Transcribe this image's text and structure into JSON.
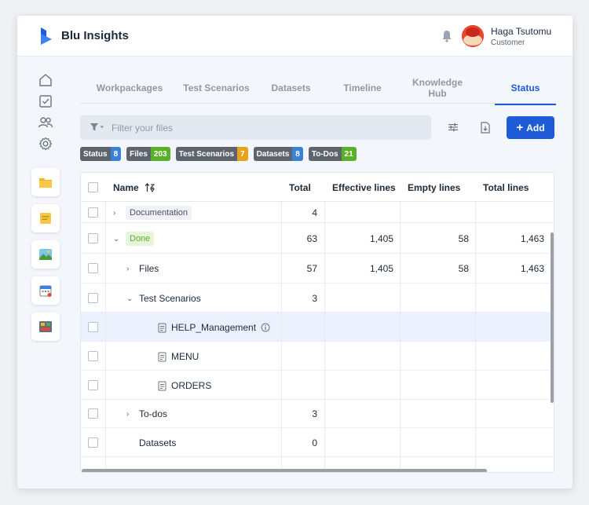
{
  "app": {
    "brand": "Blu Insights"
  },
  "user": {
    "name": "Haga Tsutomu",
    "role": "Customer"
  },
  "tabs": [
    {
      "label": "Workpackages",
      "active": false
    },
    {
      "label": "Test Scenarios",
      "active": false
    },
    {
      "label": "Datasets",
      "active": false
    },
    {
      "label": "Timeline",
      "active": false
    },
    {
      "label": "Knowledge Hub",
      "active": false
    },
    {
      "label": "Status",
      "active": true
    }
  ],
  "filter": {
    "placeholder": "Filter your files",
    "value": ""
  },
  "toolbar": {
    "add_label": "Add"
  },
  "badges": [
    {
      "label": "Status",
      "count": "8",
      "color": "#3b82d6"
    },
    {
      "label": "Files",
      "count": "203",
      "color": "#5bb02a"
    },
    {
      "label": "Test Scenarios",
      "count": "7",
      "color": "#e8a21c"
    },
    {
      "label": "Datasets",
      "count": "8",
      "color": "#3b82d6"
    },
    {
      "label": "To-Dos",
      "count": "21",
      "color": "#5bb02a"
    }
  ],
  "table": {
    "headers": {
      "name": "Name",
      "total": "Total",
      "effective": "Effective lines",
      "empty": "Empty lines",
      "total_lines": "Total lines"
    },
    "rows": [
      {
        "name": "Documentation",
        "style": "grey",
        "chevron": "›",
        "indent": 0,
        "total": "4",
        "effective": "",
        "empty": "",
        "total_lines": ""
      },
      {
        "name": "Done",
        "style": "green",
        "chevron": "⌄",
        "indent": 0,
        "total": "63",
        "effective": "1,405",
        "empty": "58",
        "total_lines": "1,463"
      },
      {
        "name": "Files",
        "style": "plain",
        "chevron": "›",
        "indent": 1,
        "total": "57",
        "effective": "1,405",
        "empty": "58",
        "total_lines": "1,463"
      },
      {
        "name": "Test Scenarios",
        "style": "plain",
        "chevron": "⌄",
        "indent": 1,
        "total": "3",
        "effective": "",
        "empty": "",
        "total_lines": ""
      },
      {
        "name": "HELP_Management",
        "style": "file",
        "chevron": "",
        "indent": 2,
        "total": "",
        "effective": "",
        "empty": "",
        "total_lines": "",
        "selected": true,
        "info": true
      },
      {
        "name": "MENU",
        "style": "file",
        "chevron": "",
        "indent": 2,
        "total": "",
        "effective": "",
        "empty": "",
        "total_lines": ""
      },
      {
        "name": "ORDERS",
        "style": "file",
        "chevron": "",
        "indent": 2,
        "total": "",
        "effective": "",
        "empty": "",
        "total_lines": ""
      },
      {
        "name": "To-dos",
        "style": "plain",
        "chevron": "›",
        "indent": 1,
        "total": "3",
        "effective": "",
        "empty": "",
        "total_lines": ""
      },
      {
        "name": "Datasets",
        "style": "plain",
        "chevron": "",
        "indent": 1,
        "total": "0",
        "effective": "",
        "empty": "",
        "total_lines": ""
      }
    ]
  }
}
